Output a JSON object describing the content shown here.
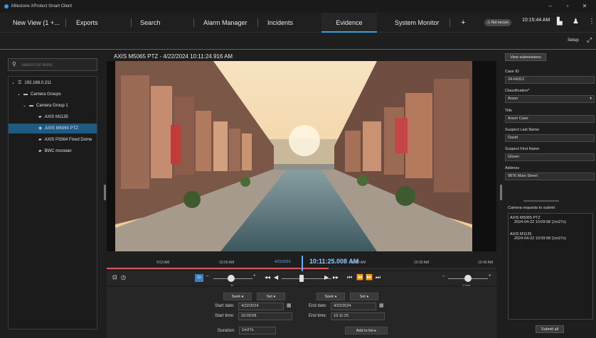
{
  "window": {
    "title": "Milestone XProtect Smart Client",
    "controls": [
      "–",
      "▫",
      "✕"
    ]
  },
  "nav": {
    "tabs": [
      "New View (1 +...",
      "Exports",
      "Search",
      "Alarm Manager",
      "Incidents",
      "Evidence",
      "System Monitor",
      "+"
    ],
    "active": "Evidence",
    "not_secure": "⚠ Not secure",
    "time": "10:15:44 AM",
    "setup": "Setup"
  },
  "left": {
    "search_placeholder": "Search for items",
    "tree": [
      "192.168.0.211",
      "Camera Groups",
      "Camera Group 1",
      "AXIS M1135",
      "AXIS M5065 PTZ",
      "AXIS P3364 Fixed Dome",
      "BWC mcowan"
    ],
    "selected": "AXIS M5065 PTZ"
  },
  "video": {
    "title": "AXIS M5065 PTZ - 4/22/2024 10:11:24.916 AM"
  },
  "timeline": {
    "labels": [
      "9:53 AM",
      "10:00 AM",
      "4/22/2024",
      "10:20 AM",
      "10:30 AM",
      "10:40 AM"
    ],
    "current_date": "4/22/2024",
    "current_time": "10:11:25.008 AM"
  },
  "controls": {
    "speed": "1x",
    "speed_label": "1x",
    "range_label": "1 hour",
    "speed_level": 0.45,
    "range_level": 0.5
  },
  "form": {
    "seek": "Seek ♦",
    "set": "Set ♦",
    "start_date_label": "Start date:",
    "start_date": "4/22/2024",
    "start_time_label": "Start time:",
    "start_time": "10:09:58",
    "end_date_label": "End date:",
    "end_date": "4/22/2024",
    "end_time_label": "End time:",
    "end_time": "10:11:25",
    "duration_label": "Duration:",
    "duration": "1m27s",
    "add_to_list": "Add to list ▸"
  },
  "right": {
    "view_submissions": "View submissions",
    "case_id_label": "Case ID",
    "case_id": "24-64312",
    "classification_label": "Classification*",
    "classification": "Arson",
    "title_label": "Title",
    "title": "Arson Case",
    "suspect_last_label": "Suspect Last Name",
    "suspect_last": "David",
    "suspect_first_label": "Suspect First Name",
    "suspect_first": "Glover",
    "address_label": "Address",
    "address": "9876 Main Street",
    "requests_label": "Camera requests to submit",
    "requests": [
      {
        "camera": "AXIS M5065 PTZ",
        "detail": "2024-04-22 10:09:58 (1m27s)"
      },
      {
        "camera": "AXIS M1135",
        "detail": "2024-04-22 10:09:58 (1m27s)"
      }
    ],
    "submit_all": "Submit all"
  }
}
